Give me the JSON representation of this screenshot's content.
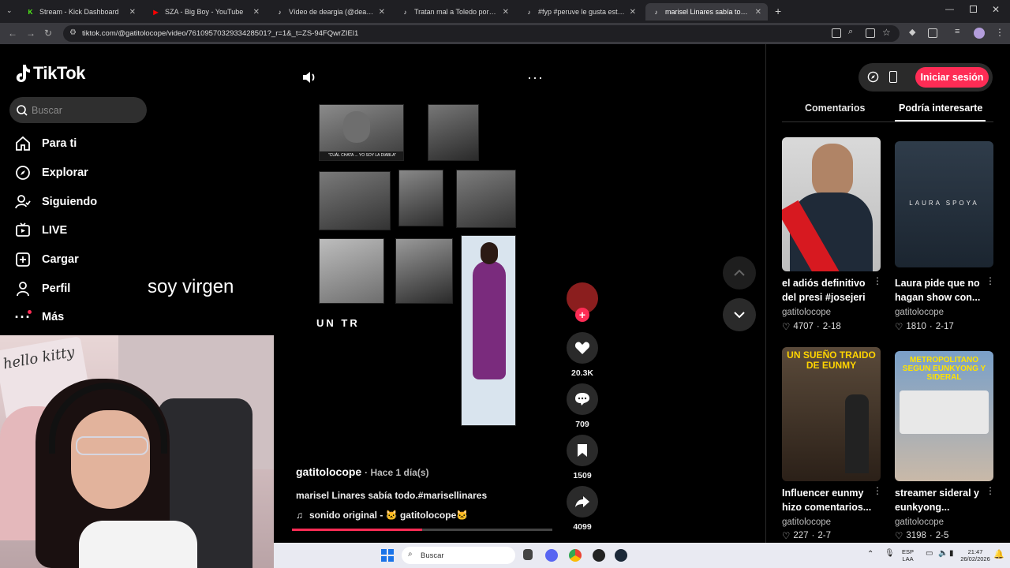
{
  "browser": {
    "tabs": [
      {
        "title": "Stream - Kick Dashboard",
        "icon": "kick-icon",
        "color": "#53fc18"
      },
      {
        "title": "SZA - Big Boy - YouTube",
        "icon": "youtube-icon",
        "color": "#ff0000"
      },
      {
        "title": "Vídeo de deargia (@deargia) re",
        "icon": "tiktok-icon",
        "color": "#ffffff"
      },
      {
        "title": "Tratan mal a Toledo por ser po",
        "icon": "tiktok-icon",
        "color": "#ffffff"
      },
      {
        "title": "#fyp #peruve le gusta este colo",
        "icon": "tiktok-icon",
        "color": "#ffffff"
      },
      {
        "title": "marisel Linares sabía todo.",
        "icon": "tiktok-icon",
        "color": "#ffffff"
      }
    ],
    "url": "tiktok.com/@gatitolocope/video/7610957032933428501?_r=1&_t=ZS-94FQwrZIEl1"
  },
  "sidebar": {
    "logo_text": "TikTok",
    "search_placeholder": "Buscar",
    "items": [
      {
        "label": "Para ti",
        "icon": "home-icon"
      },
      {
        "label": "Explorar",
        "icon": "compass-icon"
      },
      {
        "label": "Siguiendo",
        "icon": "following-icon"
      },
      {
        "label": "LIVE",
        "icon": "live-icon"
      },
      {
        "label": "Cargar",
        "icon": "upload-icon"
      },
      {
        "label": "Perfil",
        "icon": "profile-icon"
      },
      {
        "label": "Más",
        "icon": "more-icon"
      }
    ]
  },
  "overlay_text": "soy virgen",
  "video": {
    "caption_strip": "\"CUÁL CHATA ... YO SOY LA DIABLA\"",
    "overlay_word": "UN TR",
    "author": "gatitolocope",
    "time_ago": "· Hace 1 día(s)",
    "description": "marisel Linares sabía todo.#marisellinares",
    "sound": "sonido original - 🐱 gatitolocope🐱",
    "progress": 0.5
  },
  "actions": {
    "likes": "20.3K",
    "comments": "709",
    "saves": "1509",
    "shares": "4099"
  },
  "right_panel": {
    "login_label": "Iniciar sesión",
    "tabs": [
      "Comentarios",
      "Podría interesarte"
    ],
    "cards": [
      {
        "title": "el adiós definitivo del presi #josejeri",
        "author": "gatitolocope",
        "likes": "4707",
        "date": "2-18"
      },
      {
        "title": "Laura pide que no hagan show con...",
        "author": "gatitolocope",
        "likes": "1810",
        "date": "2-17",
        "thumb_text": "LAURA SPOYA"
      },
      {
        "title": "Influencer eunmy hizo comentarios...",
        "author": "gatitolocope",
        "likes": "227",
        "date": "2-7",
        "thumb_text": "UN SUEÑO TRAIDO DE EUNMY"
      },
      {
        "title": "streamer sideral y eunkyong...",
        "author": "gatitolocope",
        "likes": "3198",
        "date": "2-5",
        "thumb_text": "METROPOLITANO SEGUN EUNKYONG Y SIDERAL"
      }
    ]
  },
  "taskbar": {
    "search": "Buscar",
    "lang": "ESP",
    "lang2": "LAA",
    "time": "21:47",
    "date": "26/02/2026"
  }
}
